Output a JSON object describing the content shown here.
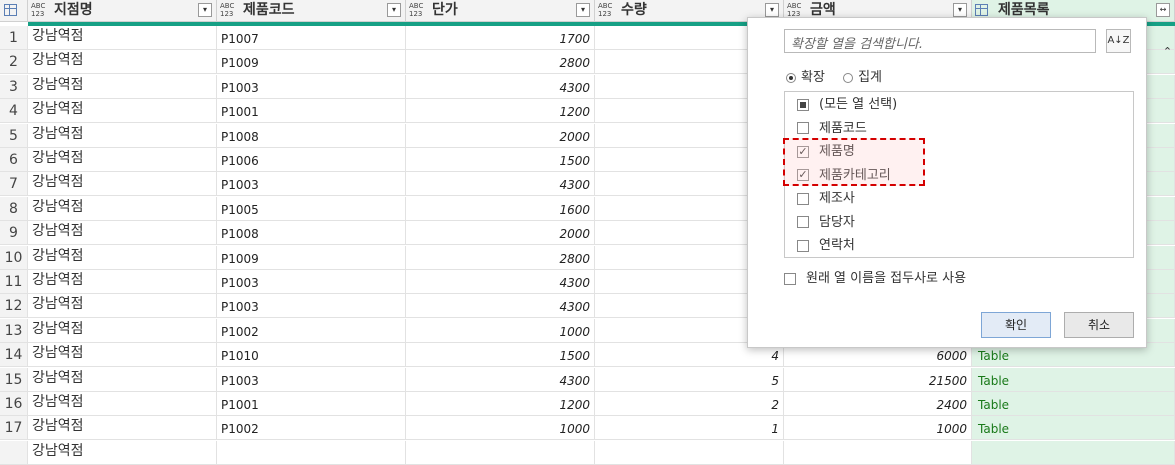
{
  "columns": [
    {
      "type_label": "ABC\n123",
      "label": "지점명",
      "bar_color": "#16a085"
    },
    {
      "type_label": "ABC\n123",
      "label": "제품코드",
      "bar_color": "#16a085"
    },
    {
      "type_label": "ABC\n123",
      "label": "단가",
      "bar_color": "#16a085"
    },
    {
      "type_label": "ABC\n123",
      "label": "수량",
      "bar_color": "#16a085"
    },
    {
      "type_label": "ABC\n123",
      "label": "금액",
      "bar_color": "#16a085"
    },
    {
      "type_label": "",
      "label": "제품목록",
      "bar_color": "#16a085"
    }
  ],
  "expand_icon_label": "↔",
  "rows": [
    {
      "n": "1",
      "branch": "강남역점",
      "code": "P1007",
      "price": "1700",
      "qty": "",
      "amount": "",
      "list": ""
    },
    {
      "n": "2",
      "branch": "강남역점",
      "code": "P1009",
      "price": "2800",
      "qty": "",
      "amount": "",
      "list": ""
    },
    {
      "n": "3",
      "branch": "강남역점",
      "code": "P1003",
      "price": "4300",
      "qty": "",
      "amount": "",
      "list": ""
    },
    {
      "n": "4",
      "branch": "강남역점",
      "code": "P1001",
      "price": "1200",
      "qty": "",
      "amount": "",
      "list": ""
    },
    {
      "n": "5",
      "branch": "강남역점",
      "code": "P1008",
      "price": "2000",
      "qty": "",
      "amount": "",
      "list": ""
    },
    {
      "n": "6",
      "branch": "강남역점",
      "code": "P1006",
      "price": "1500",
      "qty": "",
      "amount": "",
      "list": ""
    },
    {
      "n": "7",
      "branch": "강남역점",
      "code": "P1003",
      "price": "4300",
      "qty": "",
      "amount": "",
      "list": ""
    },
    {
      "n": "8",
      "branch": "강남역점",
      "code": "P1005",
      "price": "1600",
      "qty": "",
      "amount": "",
      "list": ""
    },
    {
      "n": "9",
      "branch": "강남역점",
      "code": "P1008",
      "price": "2000",
      "qty": "",
      "amount": "",
      "list": ""
    },
    {
      "n": "10",
      "branch": "강남역점",
      "code": "P1009",
      "price": "2800",
      "qty": "",
      "amount": "",
      "list": ""
    },
    {
      "n": "11",
      "branch": "강남역점",
      "code": "P1003",
      "price": "4300",
      "qty": "",
      "amount": "",
      "list": ""
    },
    {
      "n": "12",
      "branch": "강남역점",
      "code": "P1003",
      "price": "4300",
      "qty": "",
      "amount": "",
      "list": ""
    },
    {
      "n": "13",
      "branch": "강남역점",
      "code": "P1002",
      "price": "1000",
      "qty": "",
      "amount": "",
      "list": ""
    },
    {
      "n": "14",
      "branch": "강남역점",
      "code": "P1010",
      "price": "1500",
      "qty": "4",
      "amount": "6000",
      "list": "Table"
    },
    {
      "n": "15",
      "branch": "강남역점",
      "code": "P1003",
      "price": "4300",
      "qty": "5",
      "amount": "21500",
      "list": "Table"
    },
    {
      "n": "16",
      "branch": "강남역점",
      "code": "P1001",
      "price": "1200",
      "qty": "2",
      "amount": "2400",
      "list": "Table"
    },
    {
      "n": "17",
      "branch": "강남역점",
      "code": "P1002",
      "price": "1000",
      "qty": "1",
      "amount": "1000",
      "list": "Table"
    },
    {
      "n": "",
      "branch": "강남역점",
      "code": "",
      "price": "",
      "qty": "",
      "amount": "",
      "list": ""
    }
  ],
  "popup": {
    "search_placeholder": "확장할 열을 검색합니다.",
    "sort_label": "A↓Z",
    "radio_expand": "확장",
    "radio_aggregate": "집계",
    "items": [
      {
        "label": "(모든 열 선택)",
        "state": "partial"
      },
      {
        "label": "제품코드",
        "state": "unchecked"
      },
      {
        "label": "제품명",
        "state": "checked"
      },
      {
        "label": "제품카테고리",
        "state": "checked"
      },
      {
        "label": "제조사",
        "state": "unchecked"
      },
      {
        "label": "담당자",
        "state": "unchecked"
      },
      {
        "label": "연락처",
        "state": "unchecked"
      }
    ],
    "prefix_label": "원래 열 이름을 접두사로 사용",
    "ok_label": "확인",
    "cancel_label": "취소"
  },
  "colors": {
    "accent": "#16a085",
    "table_bg": "#dff3e6",
    "highlight": "#d40000"
  }
}
